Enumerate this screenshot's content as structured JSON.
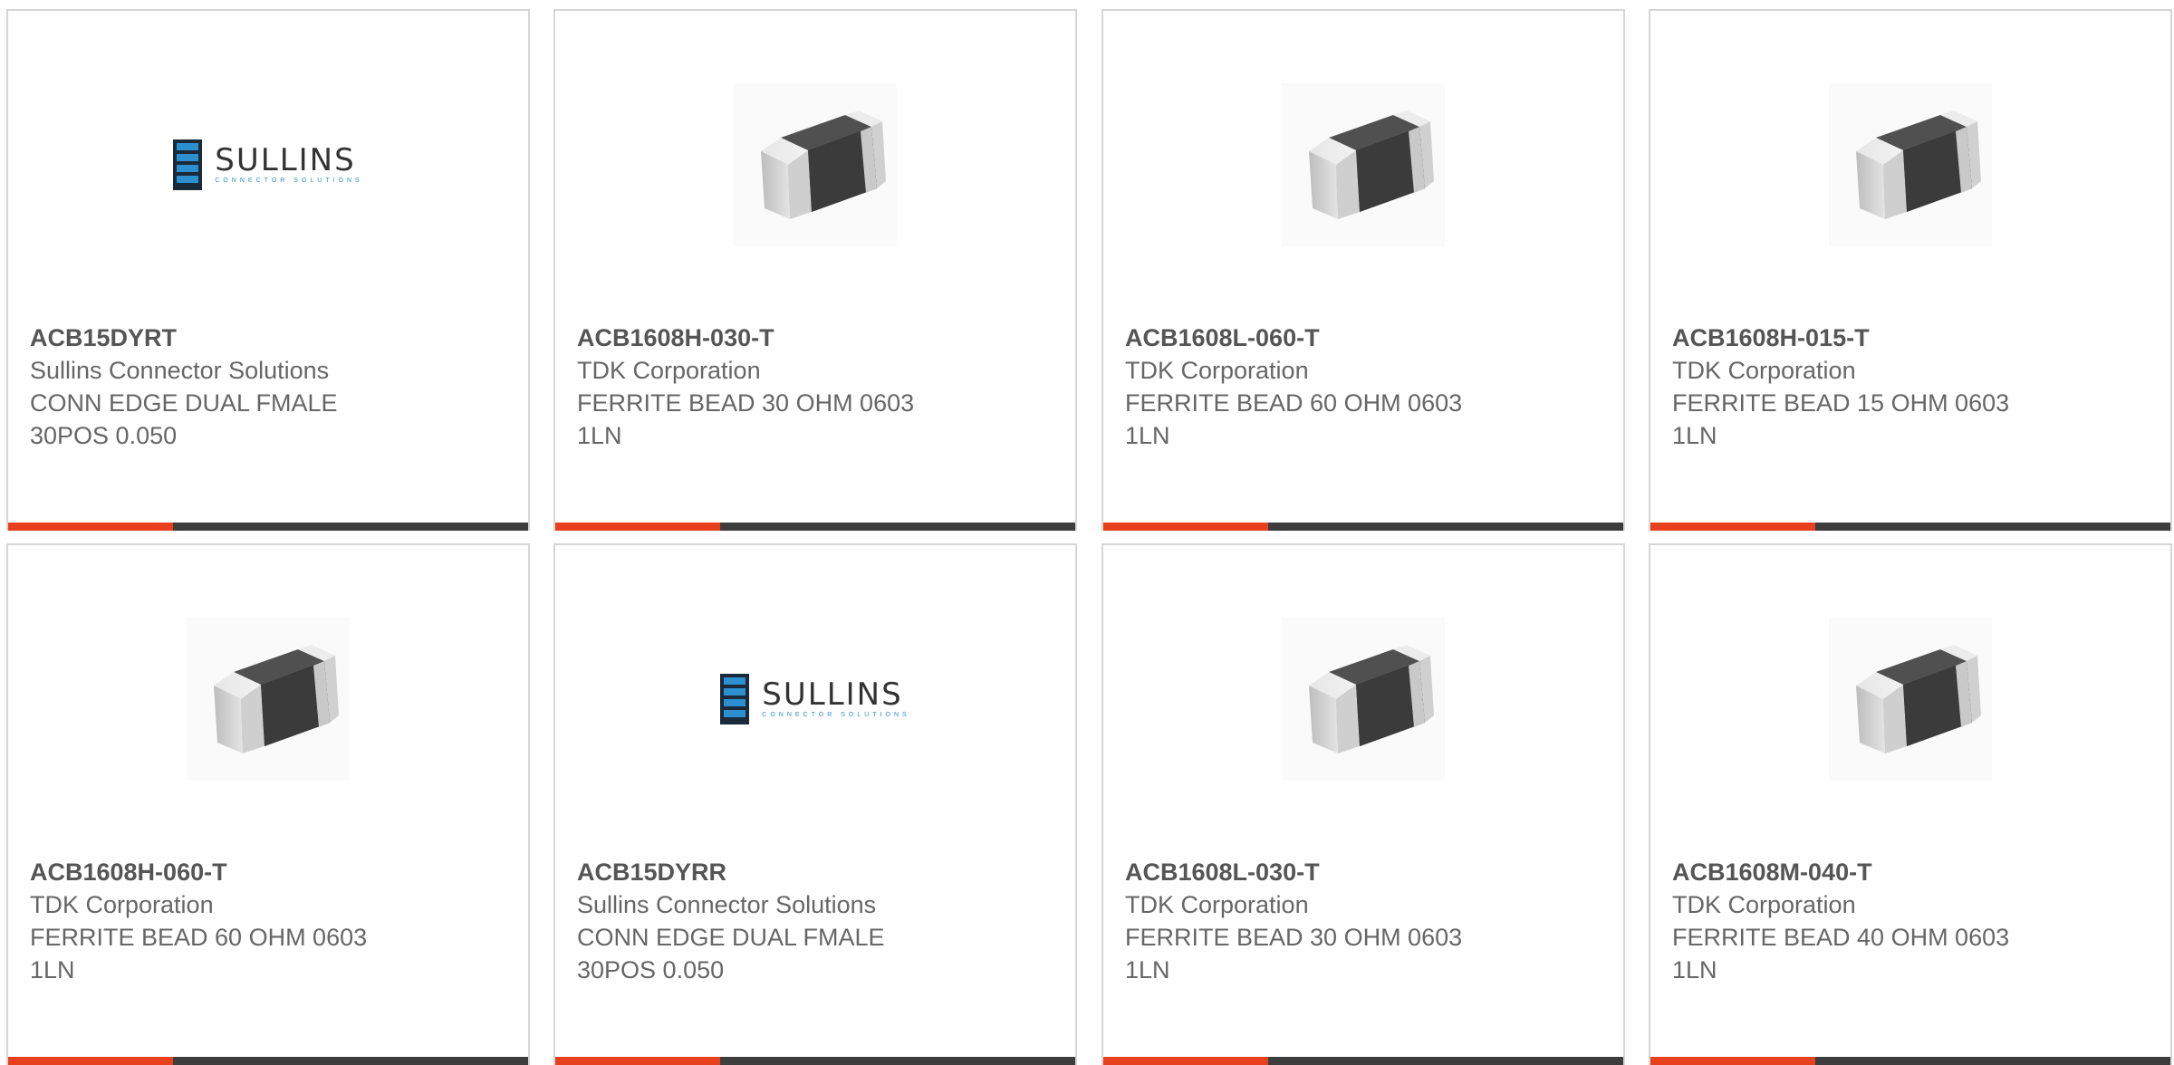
{
  "colors": {
    "accent": "#e8401c",
    "bar_rest": "#3d3d3d",
    "border": "#d6d6d6",
    "text": "#666666",
    "sullins_blue": "#2b8fd0"
  },
  "sullins_logo": {
    "title": "SULLINS",
    "subtitle": "CONNECTOR SOLUTIONS"
  },
  "products": [
    {
      "part_number": "ACB15DYRT",
      "manufacturer": "Sullins Connector Solutions",
      "description_line1": "CONN EDGE DUAL FMALE",
      "description_line2": "30POS 0.050",
      "image": "sullins-logo"
    },
    {
      "part_number": "ACB1608H-030-T",
      "manufacturer": "TDK Corporation",
      "description_line1": "FERRITE BEAD 30 OHM 0603",
      "description_line2": "1LN",
      "image": "ferrite-chip"
    },
    {
      "part_number": "ACB1608L-060-T",
      "manufacturer": "TDK Corporation",
      "description_line1": "FERRITE BEAD 60 OHM 0603",
      "description_line2": "1LN",
      "image": "ferrite-chip"
    },
    {
      "part_number": "ACB1608H-015-T",
      "manufacturer": "TDK Corporation",
      "description_line1": "FERRITE BEAD 15 OHM 0603",
      "description_line2": "1LN",
      "image": "ferrite-chip"
    },
    {
      "part_number": "ACB1608H-060-T",
      "manufacturer": "TDK Corporation",
      "description_line1": "FERRITE BEAD 60 OHM 0603",
      "description_line2": "1LN",
      "image": "ferrite-chip"
    },
    {
      "part_number": "ACB15DYRR",
      "manufacturer": "Sullins Connector Solutions",
      "description_line1": "CONN EDGE DUAL FMALE",
      "description_line2": "30POS 0.050",
      "image": "sullins-logo"
    },
    {
      "part_number": "ACB1608L-030-T",
      "manufacturer": "TDK Corporation",
      "description_line1": "FERRITE BEAD 30 OHM 0603",
      "description_line2": "1LN",
      "image": "ferrite-chip"
    },
    {
      "part_number": "ACB1608M-040-T",
      "manufacturer": "TDK Corporation",
      "description_line1": "FERRITE BEAD 40 OHM 0603",
      "description_line2": "1LN",
      "image": "ferrite-chip"
    }
  ]
}
